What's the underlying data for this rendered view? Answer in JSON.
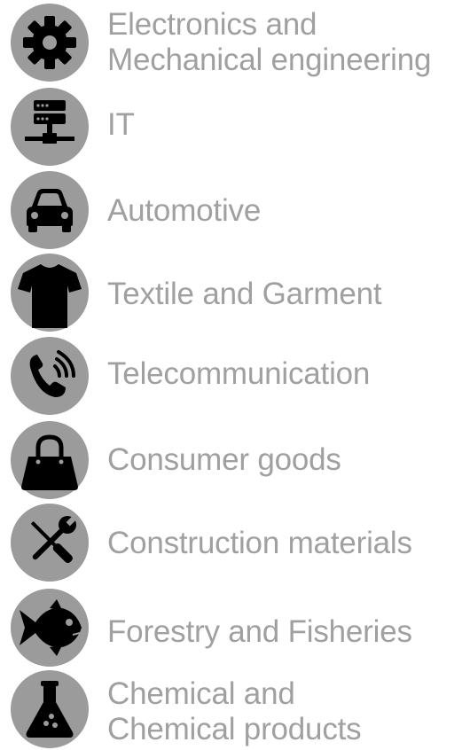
{
  "colors": {
    "circle": "#9b9b9b",
    "glyph": "#000000",
    "text": "#a0a0a0"
  },
  "sectors": [
    {
      "icon": "gear-icon",
      "lines": [
        "Electronics and",
        "Mechanical engineering"
      ]
    },
    {
      "icon": "server-network-icon",
      "lines": [
        "IT"
      ]
    },
    {
      "icon": "car-icon",
      "lines": [
        "Automotive"
      ]
    },
    {
      "icon": "t-shirt-icon",
      "lines": [
        "Textile and Garment"
      ]
    },
    {
      "icon": "phone-signal-icon",
      "lines": [
        "Telecommunication"
      ]
    },
    {
      "icon": "shopping-bag-icon",
      "lines": [
        "Consumer goods"
      ]
    },
    {
      "icon": "screwdriver-wrench-icon",
      "lines": [
        "Construction materials"
      ]
    },
    {
      "icon": "fish-icon",
      "lines": [
        "Forestry and Fisheries"
      ]
    },
    {
      "icon": "flask-icon",
      "lines": [
        "Chemical and",
        "Chemical products"
      ]
    }
  ]
}
